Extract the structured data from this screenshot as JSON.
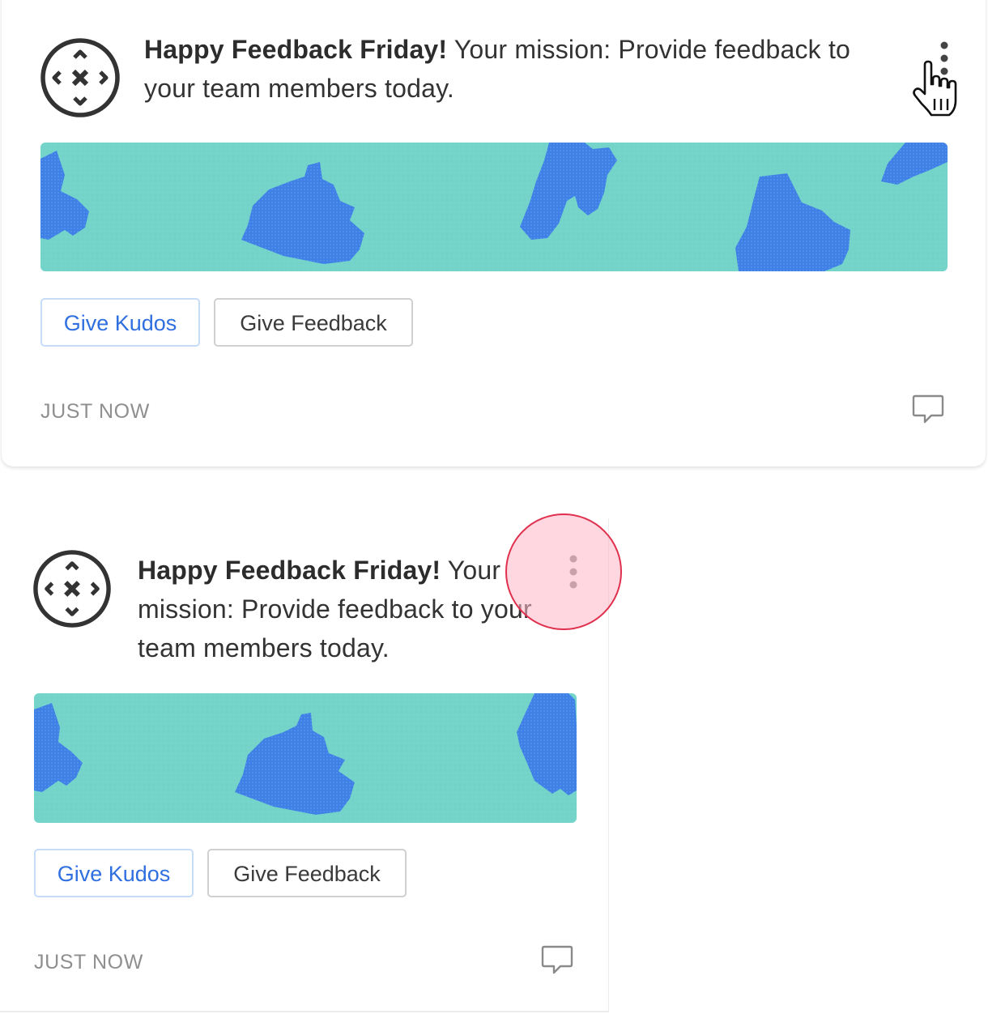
{
  "colors": {
    "banner_background": "#74d4c9",
    "banner_blobs": "#3f80e6",
    "kudos_text": "#2f6fe0",
    "kudos_border": "#c7dcf6",
    "touch_indicator": "#e0304e"
  },
  "feed": [
    {
      "logo_icon": "compass-arrows-logo-icon",
      "headline": "Happy Feedback Friday!",
      "body": " Your mission: Provide feedback to your team members today.",
      "more_icon": "kebab-menu-icon",
      "banner_image": "teal-blue-pattern-banner",
      "kudos_label": "Give Kudos",
      "feedback_label": "Give Feedback",
      "timestamp": "JUST NOW",
      "comment_icon": "comment-icon"
    },
    {
      "logo_icon": "compass-arrows-logo-icon",
      "headline": "Happy Feedback Friday!",
      "body": " Your mission: Provide feedback to your team members today.",
      "more_icon": "kebab-menu-icon",
      "banner_image": "teal-blue-pattern-banner",
      "kudos_label": "Give Kudos",
      "feedback_label": "Give Feedback",
      "timestamp": "JUST NOW",
      "comment_icon": "comment-icon"
    }
  ],
  "pointer": {
    "icon": "hand-pointer-cursor-icon"
  },
  "touch_indicator": {
    "icon": "tap-indicator-circle"
  }
}
